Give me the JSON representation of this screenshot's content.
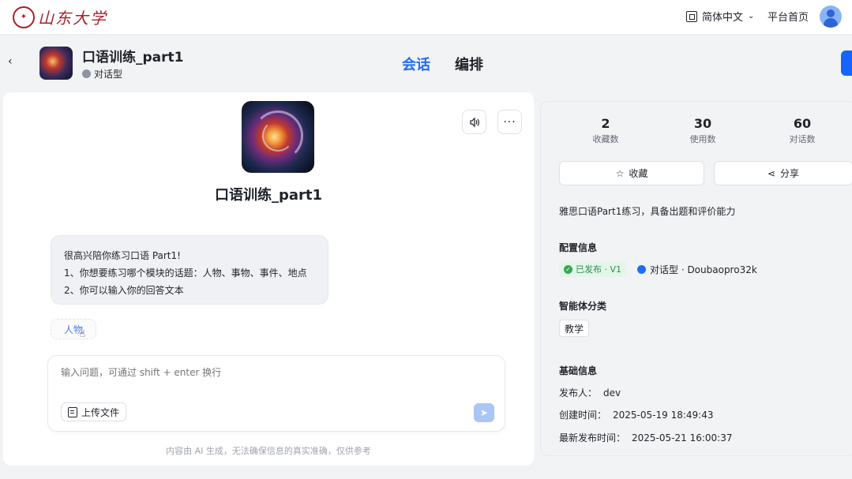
{
  "topbar": {
    "logo_text": "山东大学",
    "language": "简体中文",
    "home": "平台首页"
  },
  "header": {
    "agent_name": "口语训练_part1",
    "agent_type": "对话型",
    "tabs": [
      {
        "label": "会话",
        "active": true
      },
      {
        "label": "编排",
        "active": false
      }
    ]
  },
  "chat": {
    "title": "口语训练_part1",
    "greeting_lines": [
      "很高兴陪你练习口语 Part1!",
      "1、你想要练习哪个模块的话题：人物、事物、事件、地点",
      "2、你可以输入你的回答文本"
    ],
    "suggestion": "人物",
    "input_placeholder": "输入问题，可通过 shift + enter 换行",
    "upload_label": "上传文件",
    "disclaimer": "内容由 AI 生成，无法确保信息的真实准确，仅供参考"
  },
  "info": {
    "stats": [
      {
        "value": "2",
        "label": "收藏数"
      },
      {
        "value": "30",
        "label": "使用数"
      },
      {
        "value": "60",
        "label": "对话数"
      }
    ],
    "favorite_label": "收藏",
    "share_label": "分享",
    "description": "雅思口语Part1练习，具备出题和评价能力",
    "config_title": "配置信息",
    "publish_badge": "已发布 · V1",
    "model_info": "对话型 · Doubaopro32k",
    "category_title": "智能体分类",
    "category_tag": "教学",
    "basic_title": "基础信息",
    "publisher_label": "发布人：",
    "publisher": "dev",
    "created_label": "创建时间：",
    "created": "2025-05-19 18:49:43",
    "latest_label": "最新发布时间：",
    "latest": "2025-05-21 16:00:37"
  },
  "colors": {
    "accent": "#1f6df6",
    "brand": "#a3212a",
    "success": "#34a853"
  }
}
